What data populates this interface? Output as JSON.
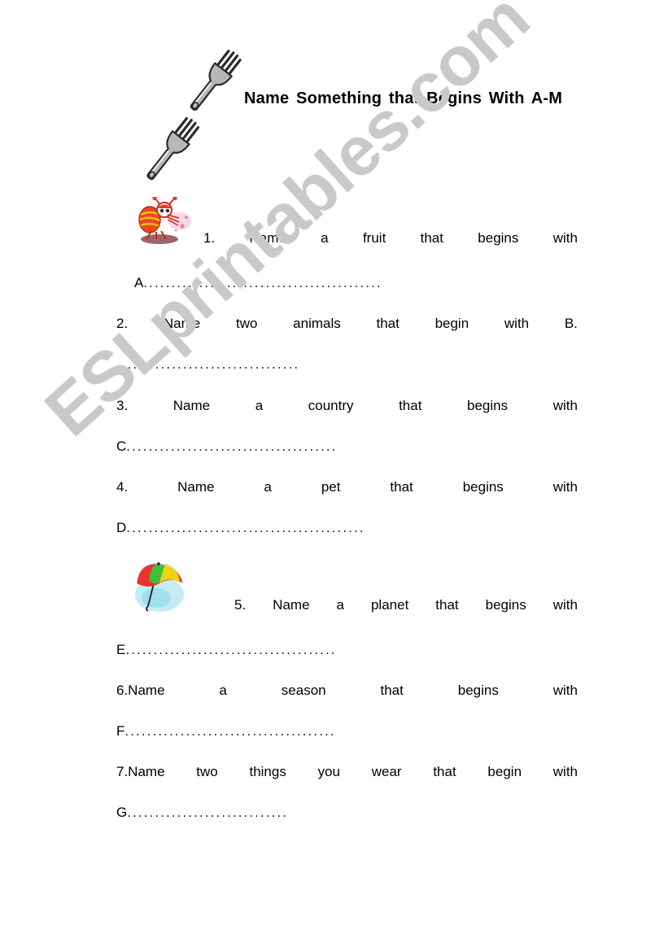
{
  "document": {
    "title": "Name Something that Begins With A-M",
    "watermark": "ESLprintables.com",
    "watermark_color": "#c9c9c9",
    "background_color": "#ffffff",
    "text_color": "#000000"
  },
  "decorations": [
    {
      "name": "fork-top",
      "icon": "fork-icon",
      "color": "#8a8a8a"
    },
    {
      "name": "fork-bottom",
      "icon": "fork-icon",
      "color": "#8a8a8a"
    },
    {
      "name": "bug-clipart",
      "icon": "ant-icon",
      "color": "#e03a2f"
    },
    {
      "name": "umbrella-clipart",
      "icon": "umbrella-icon",
      "color": "#7fd4e8"
    }
  ],
  "questions": [
    {
      "number": "1.",
      "words": [
        "1.",
        "Name",
        "a",
        "fruit",
        "that",
        "begins",
        "with"
      ],
      "answer_letter": "A",
      "answer_dots": "..........................................."
    },
    {
      "number": "2.",
      "words": [
        "2.",
        "Name",
        "two",
        "animals",
        "that",
        "begin",
        "with",
        "B."
      ],
      "answer_letter": "",
      "answer_dots": "................................."
    },
    {
      "number": "3.",
      "words": [
        "3.",
        "Name",
        "a",
        "country",
        "that",
        "begins",
        "with"
      ],
      "answer_letter": "C",
      "answer_dots": "......................................"
    },
    {
      "number": "4.",
      "words": [
        "4.",
        "Name",
        "a",
        "pet",
        "that",
        "begins",
        "with"
      ],
      "answer_letter": "D",
      "answer_dots": "..........................................."
    },
    {
      "number": "5.",
      "words": [
        "5.",
        "Name",
        "a",
        "planet",
        "that",
        "begins",
        "with"
      ],
      "answer_letter": "E",
      "answer_dots": "......................................"
    },
    {
      "number": "6.",
      "words": [
        "6.Name",
        "a",
        "season",
        "that",
        "begins",
        "with"
      ],
      "answer_letter": "F",
      "answer_dots": "......................................"
    },
    {
      "number": "7.",
      "words": [
        "7.Name",
        "two",
        "things",
        "you",
        "wear",
        "that",
        "begin",
        "with"
      ],
      "answer_letter": "G",
      "answer_dots": "............................."
    }
  ]
}
